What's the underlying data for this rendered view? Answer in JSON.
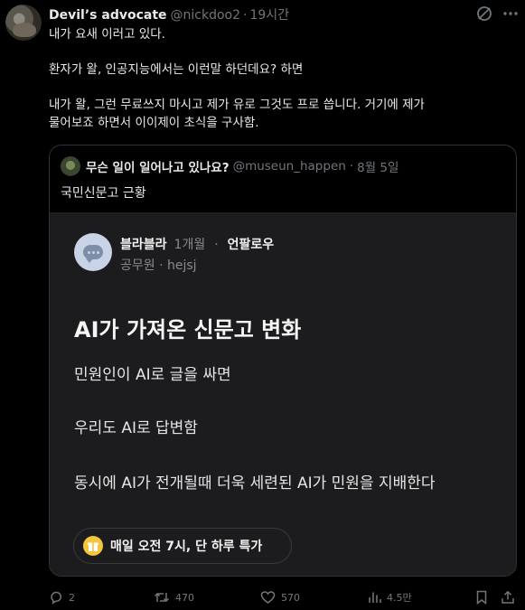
{
  "tweet": {
    "author_name": "Devil’s advocate",
    "handle": "@nickdoo2",
    "separator": "·",
    "time": "19시간",
    "lines": [
      "내가 요새 이러고 있다.",
      "",
      "환자가 왈, 인공지능에서는 이런말 하던데요? 하면",
      "",
      "내가 왈, 그런 무료쓰지 마시고 제가 유로 그것도 프로 씁니다.  거기에 제가",
      "물어보죠 하면서 이이제이 초식을 구사함."
    ]
  },
  "quote": {
    "author_name": "무슨 일이 일어나고 있나요?",
    "handle": "@museun_happen",
    "separator": "·",
    "date": "8월 5일",
    "text": "국민신문고 근황",
    "image": {
      "nickname": "블라블라",
      "age": "1개월",
      "separator": "·",
      "follow": "언팔로우",
      "meta": "공무원 · hejsj",
      "title": "AI가 가져온 신문고 변화",
      "body": [
        "민원인이 AI로 글을 싸면",
        "우리도 AI로 답변함",
        "동시에 AI가 전개될때 더욱 세련된 AI가 민원을 지배한다"
      ],
      "promo": "매일 오전 7시, 단 하루 특가"
    }
  },
  "actions": {
    "replies": "2",
    "reposts": "470",
    "likes": "570",
    "views": "4.5만"
  },
  "icons": {
    "grok": "grok-icon",
    "more": "more-icon",
    "reply": "reply-icon",
    "repost": "repost-icon",
    "like": "heart-icon",
    "views": "views-icon",
    "bookmark": "bookmark-icon",
    "share": "share-icon"
  },
  "colors": {
    "background": "#000000",
    "text": "#e7e9ea",
    "muted": "#71767b",
    "border": "#2f3336",
    "card": "#1c1c1e",
    "gift": "#f4c63b"
  }
}
